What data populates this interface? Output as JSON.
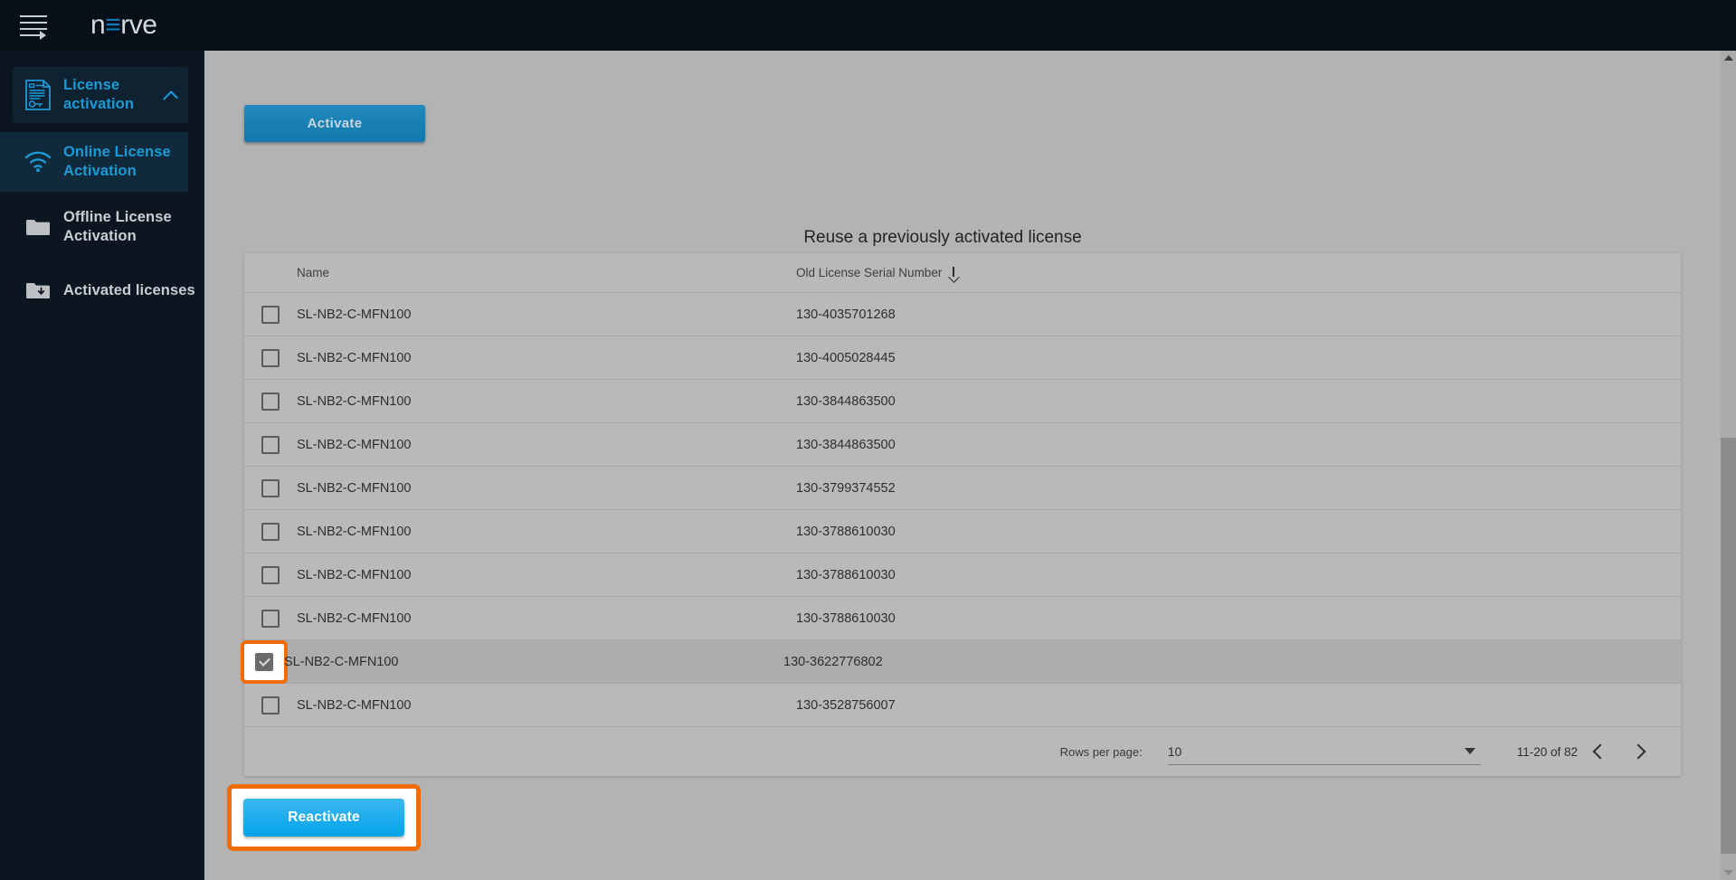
{
  "app": {
    "brand_pre": "n",
    "brand_mid": "≡",
    "brand_post": "rve",
    "menu_icon": "hamburger-icon"
  },
  "sidebar": {
    "items": [
      {
        "label": "License activation",
        "icon": "license-document-icon",
        "state": "active-parent",
        "expand_icon": "chevron-up-icon"
      },
      {
        "label": "Online License Activation",
        "icon": "wifi-icon",
        "state": "active-child"
      },
      {
        "label": "Offline License Activation",
        "icon": "folder-icon",
        "state": "plain"
      },
      {
        "label": "Activated licenses",
        "icon": "folder-download-icon",
        "state": "plain"
      }
    ]
  },
  "main": {
    "activate_label": "Activate",
    "table_title": "Reuse a previously activated license",
    "reactivate_label": "Reactivate",
    "columns": [
      {
        "key": "name",
        "label": "Name"
      },
      {
        "key": "serial",
        "label": "Old License Serial Number",
        "sort_icon": "sort-descending-arrow",
        "sorted": true
      }
    ],
    "rows": [
      {
        "checked": false,
        "name": "SL-NB2-C-MFN100",
        "serial": "130-4035701268"
      },
      {
        "checked": false,
        "name": "SL-NB2-C-MFN100",
        "serial": "130-4005028445"
      },
      {
        "checked": false,
        "name": "SL-NB2-C-MFN100",
        "serial": "130-3844863500"
      },
      {
        "checked": false,
        "name": "SL-NB2-C-MFN100",
        "serial": "130-3844863500"
      },
      {
        "checked": false,
        "name": "SL-NB2-C-MFN100",
        "serial": "130-3799374552"
      },
      {
        "checked": false,
        "name": "SL-NB2-C-MFN100",
        "serial": "130-3788610030"
      },
      {
        "checked": false,
        "name": "SL-NB2-C-MFN100",
        "serial": "130-3788610030"
      },
      {
        "checked": false,
        "name": "SL-NB2-C-MFN100",
        "serial": "130-3788610030"
      },
      {
        "checked": true,
        "name": "SL-NB2-C-MFN100",
        "serial": "130-3622776802",
        "highlighted": true
      },
      {
        "checked": false,
        "name": "SL-NB2-C-MFN100",
        "serial": "130-3528756007"
      }
    ],
    "pagination": {
      "rows_per_page_label": "Rows per page:",
      "rows_per_page_value": "10",
      "range_label": "11-20 of 82",
      "prev_icon": "chevron-left-icon",
      "next_icon": "chevron-right-icon",
      "dropdown_icon": "caret-down-icon"
    }
  },
  "colors": {
    "brand_blue": "#1179b5",
    "accent_blue": "#1c9ad6",
    "highlight_orange": "#ef6c00",
    "sidebar_bg": "#0b1620",
    "topbar_bg": "#071019",
    "content_bg": "#b3b3b3"
  }
}
